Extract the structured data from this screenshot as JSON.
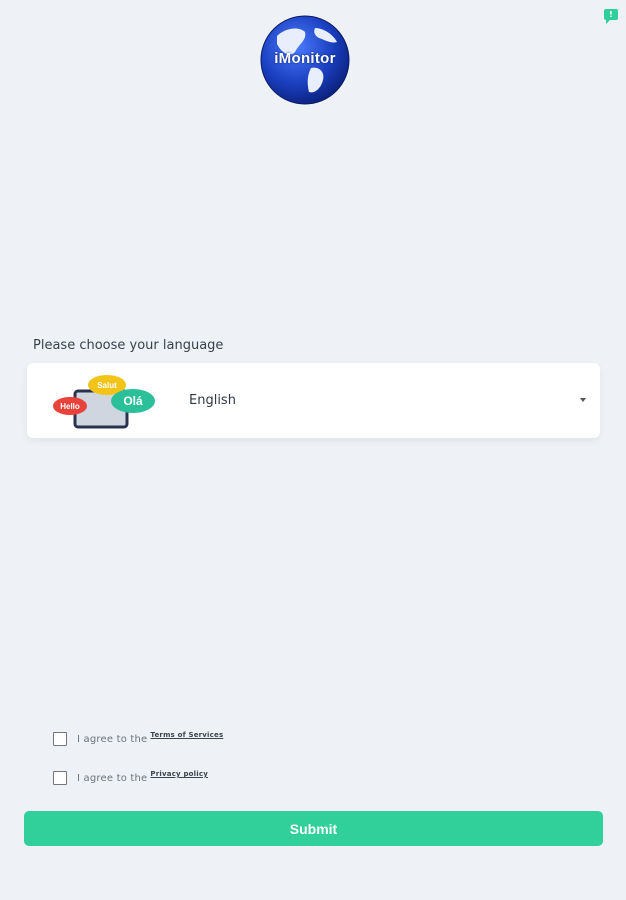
{
  "notice_badge": {
    "label": "!"
  },
  "logo": {
    "text": "iMonitor"
  },
  "language": {
    "prompt": "Please choose your language",
    "selected": "English",
    "illustration": {
      "bubble_1": "Hello",
      "bubble_2": "Salut",
      "bubble_3": "Olá"
    }
  },
  "agreements": {
    "terms": {
      "prefix": "I agree to the",
      "link": "Terms of Services"
    },
    "privacy": {
      "prefix": "I agree to the",
      "link": "Privacy policy"
    }
  },
  "submit": {
    "label": "Submit"
  },
  "colors": {
    "background": "#eef2f6",
    "accent": "#31d09a",
    "globe_blue": "#1a3fbf"
  }
}
